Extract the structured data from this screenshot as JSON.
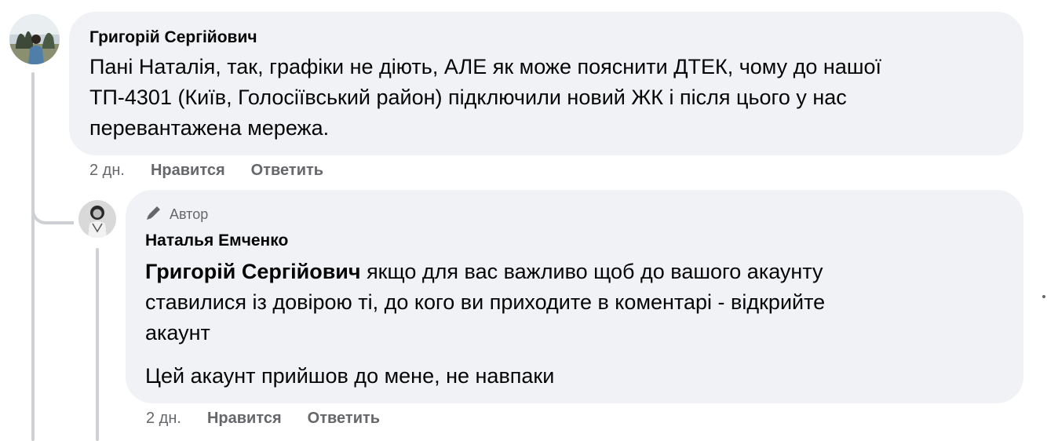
{
  "comments": [
    {
      "author": "Григорій Сергійович",
      "text_lines": [
        "Пані Наталія, так, графіки не діють, АЛЕ як може пояснити ДТЕК, чому до нашої",
        "ТП-4301 (Київ, Голосіївський район) підключили новий ЖК і після цього у нас",
        "перевантажена мережа."
      ],
      "time": "2 дн.",
      "like_label": "Нравится",
      "reply_label": "Ответить"
    }
  ],
  "reply": {
    "badge_label": "Автор",
    "author": "Наталья Емченко",
    "mention": "Григорій Сергійович",
    "line1_rest": " якщо для вас важливо щоб до вашого акаунту",
    "line2": "ставилися із довірою ті, до кого ви приходите в коментарі - відкрийте",
    "line3": "акаунт",
    "paragraph2": "Цей акаунт прийшов до мене, не навпаки",
    "time": "2 дн.",
    "like_label": "Нравится",
    "reply_label": "Ответить"
  }
}
